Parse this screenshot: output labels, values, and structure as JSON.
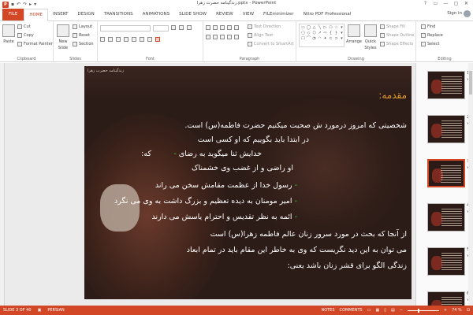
{
  "titlebar": {
    "doc_title": "زندگینامه حضرت زهرا.pptx - PowerPoint",
    "controls": [
      "?",
      "▭",
      "—",
      "▢",
      "✕"
    ]
  },
  "tabs": [
    {
      "label": "FILE"
    },
    {
      "label": "HOME"
    },
    {
      "label": "INSERT"
    },
    {
      "label": "DESIGN"
    },
    {
      "label": "TRANSITIONS"
    },
    {
      "label": "ANIMATIONS"
    },
    {
      "label": "SLIDE SHOW"
    },
    {
      "label": "REVIEW"
    },
    {
      "label": "VIEW"
    },
    {
      "label": "FILEminimizer"
    },
    {
      "label": "Nitro PDF Professional"
    }
  ],
  "account": {
    "signin": "Sign in"
  },
  "ribbon": {
    "clipboard": {
      "label": "Clipboard",
      "paste": "Paste",
      "cut": "Cut",
      "copy": "Copy",
      "format_painter": "Format Painter"
    },
    "slides": {
      "label": "Slides",
      "new_slide": "New",
      "new_slide2": "Slide",
      "layout": "Layout",
      "reset": "Reset",
      "section": "Section"
    },
    "font": {
      "label": "Font"
    },
    "paragraph": {
      "label": "Paragraph",
      "text_direction": "Text Direction",
      "align_text": "Align Text",
      "convert_smartart": "Convert to SmartArt"
    },
    "drawing": {
      "label": "Drawing",
      "arrange": "Arrange",
      "quick_styles": "Quick",
      "quick_styles2": "Styles",
      "shape_fill": "Shape Fill",
      "shape_outline": "Shape Outline",
      "shape_effects": "Shape Effects"
    },
    "editing": {
      "label": "Editing",
      "find": "Find",
      "replace": "Replace",
      "select": "Select"
    }
  },
  "slide": {
    "corner_label": "زندگینامه حضرت زهرا",
    "heading": "مقدمه:",
    "lines": [
      "شخصیتی که امروز درمورد ش صحبت میکنیم حضرت فاطمه(س) است.",
      "در ابتدا باید بگوییم که او کسی است",
      "که:",
      "خدایش ثنا میگوید به رضای",
      "او راضی و از غضب وی خشمناک",
      "رسول خدا از عظمت مقامش سخن می راند",
      "امیر مومنان به دیده تعظیم و بزرگ داشت به وی می نگرد",
      "ائمه به نظر تقدیس و احترام یاسش می دارند",
      "از آنجا که بحث در مورد سرور زنان عالم فاطمه زهرا(س) است",
      "می توان به این دید نگریست که وی به خاطر این مقام باید در تمام ابعاد",
      "زندگی الگو برای قشر زنان باشد یعنی:"
    ],
    "dash": "-"
  },
  "thumbnails": [
    {
      "num": "1",
      "star": "★"
    },
    {
      "num": "2",
      "star": "★"
    },
    {
      "num": "3",
      "star": "★"
    },
    {
      "num": "4",
      "star": "★"
    },
    {
      "num": "5",
      "star": "★"
    },
    {
      "num": "6",
      "star": "★"
    }
  ],
  "statusbar": {
    "slide_info": "SLIDE 3 OF 40",
    "language": "PERSIAN",
    "notes": "NOTES",
    "comments": "COMMENTS",
    "zoom": "74 %",
    "zoom_fraction": 0.74
  }
}
